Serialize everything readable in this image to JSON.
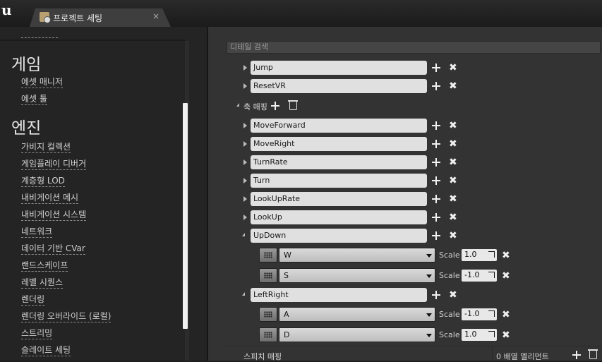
{
  "window": {
    "tab_label": "프로젝트 세팅",
    "tab_close": "×"
  },
  "sidebar": {
    "sections": [
      {
        "title": "게임",
        "items": [
          "에셋 매니저",
          "에셋 툴"
        ]
      },
      {
        "title": "엔진",
        "items": [
          "가비지 컬렉션",
          "게임플레이 디버거",
          "계층형 LOD",
          "내비게이션 메시",
          "내비게이션 시스템",
          "네트워크",
          "데이터 기반 CVar",
          "랜드스케이프",
          "레벨 시퀀스",
          "렌더링",
          "렌더링 오버라이드 (로컬)",
          "스트리밍",
          "슬레이트 세팅"
        ]
      }
    ]
  },
  "details": {
    "search_placeholder": "디테일 검색",
    "action_mappings_tail": [
      "Jump",
      "ResetVR"
    ],
    "axis_section_label": "축 매핑",
    "axis_mappings": [
      "MoveForward",
      "MoveRight",
      "TurnRate",
      "Turn",
      "LookUpRate",
      "LookUp",
      "UpDown",
      "LeftRight"
    ],
    "axis_keys": [
      {
        "key": "W",
        "scale_label": "Scale",
        "scale": "1.0"
      },
      {
        "key": "S",
        "scale_label": "Scale",
        "scale": "-1.0"
      },
      {
        "key": "A",
        "scale_label": "Scale",
        "scale": "-1.0"
      },
      {
        "key": "D",
        "scale_label": "Scale",
        "scale": "1.0"
      }
    ],
    "footer": {
      "left": "스피치 매핑",
      "right": "0 배열 엘리먼트"
    }
  }
}
